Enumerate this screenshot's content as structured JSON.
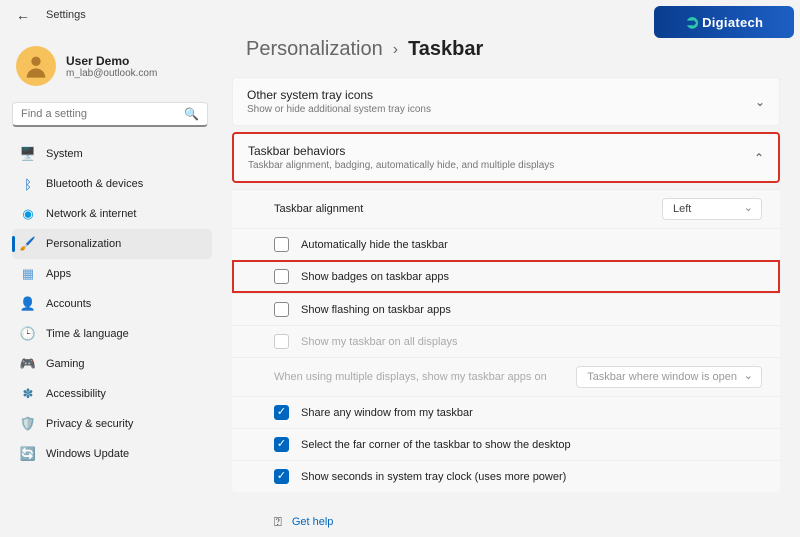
{
  "window": {
    "title": "Settings"
  },
  "logo": "Digiatech",
  "user": {
    "name": "User Demo",
    "email": "m_lab@outlook.com"
  },
  "search": {
    "placeholder": "Find a setting"
  },
  "nav": {
    "items": [
      {
        "label": "System"
      },
      {
        "label": "Bluetooth & devices"
      },
      {
        "label": "Network & internet"
      },
      {
        "label": "Personalization"
      },
      {
        "label": "Apps"
      },
      {
        "label": "Accounts"
      },
      {
        "label": "Time & language"
      },
      {
        "label": "Gaming"
      },
      {
        "label": "Accessibility"
      },
      {
        "label": "Privacy & security"
      },
      {
        "label": "Windows Update"
      }
    ]
  },
  "breadcrumb": {
    "parent": "Personalization",
    "current": "Taskbar"
  },
  "cards": {
    "tray": {
      "title": "Other system tray icons",
      "sub": "Show or hide additional system tray icons"
    },
    "behaviors": {
      "title": "Taskbar behaviors",
      "sub": "Taskbar alignment, badging, automatically hide, and multiple displays"
    }
  },
  "alignment": {
    "label": "Taskbar alignment",
    "value": "Left"
  },
  "rows": {
    "autohide": "Automatically hide the taskbar",
    "badges": "Show badges on taskbar apps",
    "flashing": "Show flashing on taskbar apps",
    "alldisplays": "Show my taskbar on all displays",
    "multi_label": "When using multiple displays, show my taskbar apps on",
    "multi_value": "Taskbar where window is open",
    "share": "Share any window from my taskbar",
    "corner": "Select the far corner of the taskbar to show the desktop",
    "seconds": "Show seconds in system tray clock (uses more power)"
  },
  "help": {
    "label": "Get help"
  }
}
